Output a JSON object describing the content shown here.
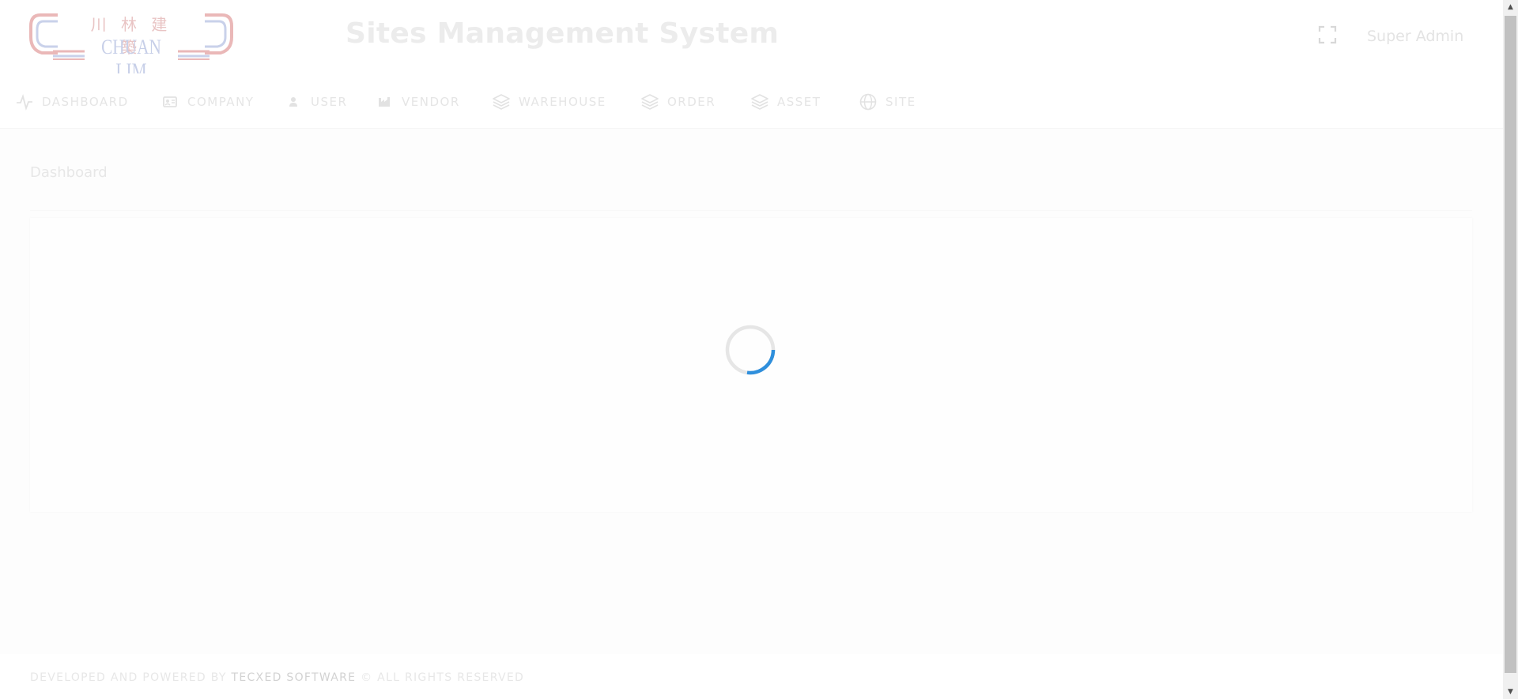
{
  "header": {
    "logo": {
      "chinese_text": "川 林 建 築",
      "latin_text": "CHUAN LIM",
      "icon": "chuan-lim-logo"
    },
    "title": "Sites Management System",
    "fullscreen_icon": "fullscreen-icon",
    "user_name": "Super Admin"
  },
  "nav": {
    "items": [
      {
        "label": "DASHBOARD",
        "icon": "activity-icon"
      },
      {
        "label": "COMPANY",
        "icon": "id-card-icon"
      },
      {
        "label": "USER",
        "icon": "user-icon"
      },
      {
        "label": "VENDOR",
        "icon": "industry-icon"
      },
      {
        "label": "WAREHOUSE",
        "icon": "layers-icon"
      },
      {
        "label": "ORDER",
        "icon": "layers-icon"
      },
      {
        "label": "ASSET",
        "icon": "layers-icon"
      },
      {
        "label": "SITE",
        "icon": "globe-icon"
      }
    ]
  },
  "main": {
    "breadcrumb": "Dashboard",
    "loading": true
  },
  "footer": {
    "prefix": "DEVELOPED AND POWERED BY",
    "brand": "TECXED SOFTWARE",
    "suffix": "© ALL RIGHTS RESERVED"
  },
  "colors": {
    "spinner_accent": "#2f8fdc",
    "spinner_track": "#e6e6e6",
    "logo_red": "#e8b8b8",
    "logo_blue": "#c4cde6"
  }
}
